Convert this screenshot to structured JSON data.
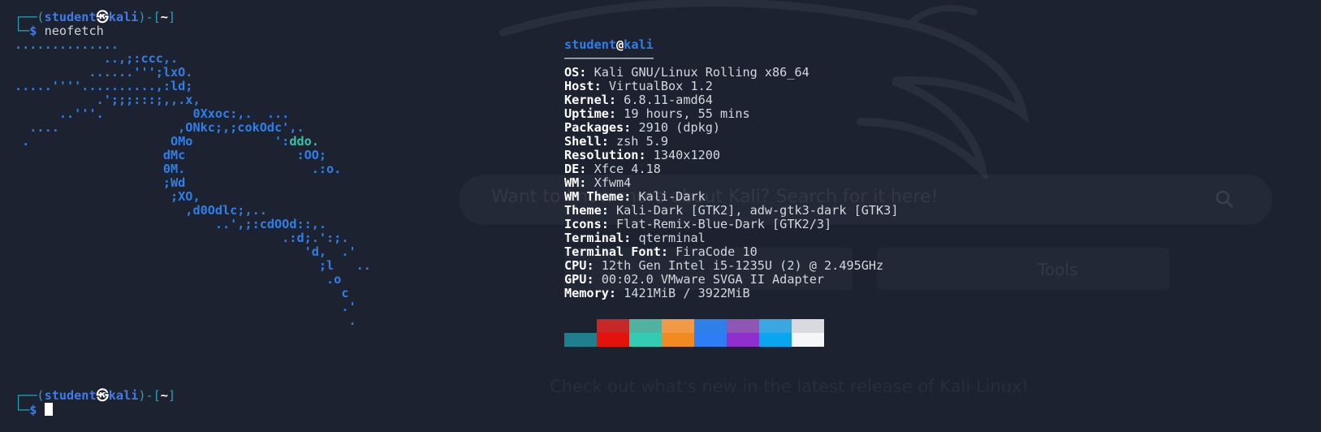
{
  "background": {
    "search_text": "Want to know more about Kali? Search for it here!",
    "button_tools": "Tools",
    "news_text": "Check out what's new in the latest release of Kali Linux!"
  },
  "prompt1": {
    "top_left": "┌──(",
    "user": "student",
    "skull": "㉿",
    "host": "kali",
    "mid": ")-[",
    "dir": "~",
    "end": "]",
    "bottom_left": "└─",
    "dollar": "$",
    "command": "neofetch"
  },
  "logo_lines": [
    "..............",
    "            ..,;:ccc,.",
    "          ......''';lxO.",
    ".....''''..........,:ld;",
    "           .';;;:::;,,.x,",
    "      ..'''.            0Xxoc:,.  ...",
    "  ....                ,ONkc;,;cokOdc',.",
    " .                   OMo           ':",
    "                    dMc               :OO;",
    "                    0M.                 .:o.",
    "                    ;Wd",
    "                     ;XO,",
    "                       ,d0Odlc;,..",
    "                           ..',;:cdOOd::,.",
    "                                    .:d;.':;.",
    "                                       'd,  .'",
    "                                         ;l   ..",
    "                                          .o",
    "                                            c",
    "                                            .'",
    "                                             ."
  ],
  "logo_green": "ddo.",
  "user": "student",
  "at": "@",
  "host": "kali",
  "underline": "────────────",
  "info": [
    {
      "key": "OS",
      "value": "Kali GNU/Linux Rolling x86_64"
    },
    {
      "key": "Host",
      "value": "VirtualBox 1.2"
    },
    {
      "key": "Kernel",
      "value": "6.8.11-amd64"
    },
    {
      "key": "Uptime",
      "value": "19 hours, 55 mins"
    },
    {
      "key": "Packages",
      "value": "2910 (dpkg)"
    },
    {
      "key": "Shell",
      "value": "zsh 5.9"
    },
    {
      "key": "Resolution",
      "value": "1340x1200"
    },
    {
      "key": "DE",
      "value": "Xfce 4.18"
    },
    {
      "key": "WM",
      "value": "Xfwm4"
    },
    {
      "key": "WM Theme",
      "value": "Kali-Dark"
    },
    {
      "key": "Theme",
      "value": "Kali-Dark [GTK2], adw-gtk3-dark [GTK3]"
    },
    {
      "key": "Icons",
      "value": "Flat-Remix-Blue-Dark [GTK2/3]"
    },
    {
      "key": "Terminal",
      "value": "qterminal"
    },
    {
      "key": "Terminal Font",
      "value": "FiraCode 10"
    },
    {
      "key": "CPU",
      "value": "12th Gen Intel i5-1235U (2) @ 2.495GHz"
    },
    {
      "key": "GPU",
      "value": "00:02.0 VMware SVGA II Adapter"
    },
    {
      "key": "Memory",
      "value": "1421MiB / 3922MiB"
    }
  ],
  "colors": {
    "row1": [
      "#1c2230",
      "#c62828",
      "#4fb3a0",
      "#f09a48",
      "#2f7fe8",
      "#8e57b4",
      "#3aa6e2",
      "#d8dadf"
    ],
    "row2": [
      "#1f7f8c",
      "#e3120b",
      "#33ccb3",
      "#f28a22",
      "#2d7df7",
      "#9030cc",
      "#0aa5ef",
      "#f4f6f8"
    ]
  },
  "prompt2": {
    "top_left": "┌──(",
    "user": "student",
    "skull": "㉿",
    "host": "kali",
    "mid": ")-[",
    "dir": "~",
    "end": "]",
    "bottom_left": "└─",
    "dollar": "$"
  }
}
